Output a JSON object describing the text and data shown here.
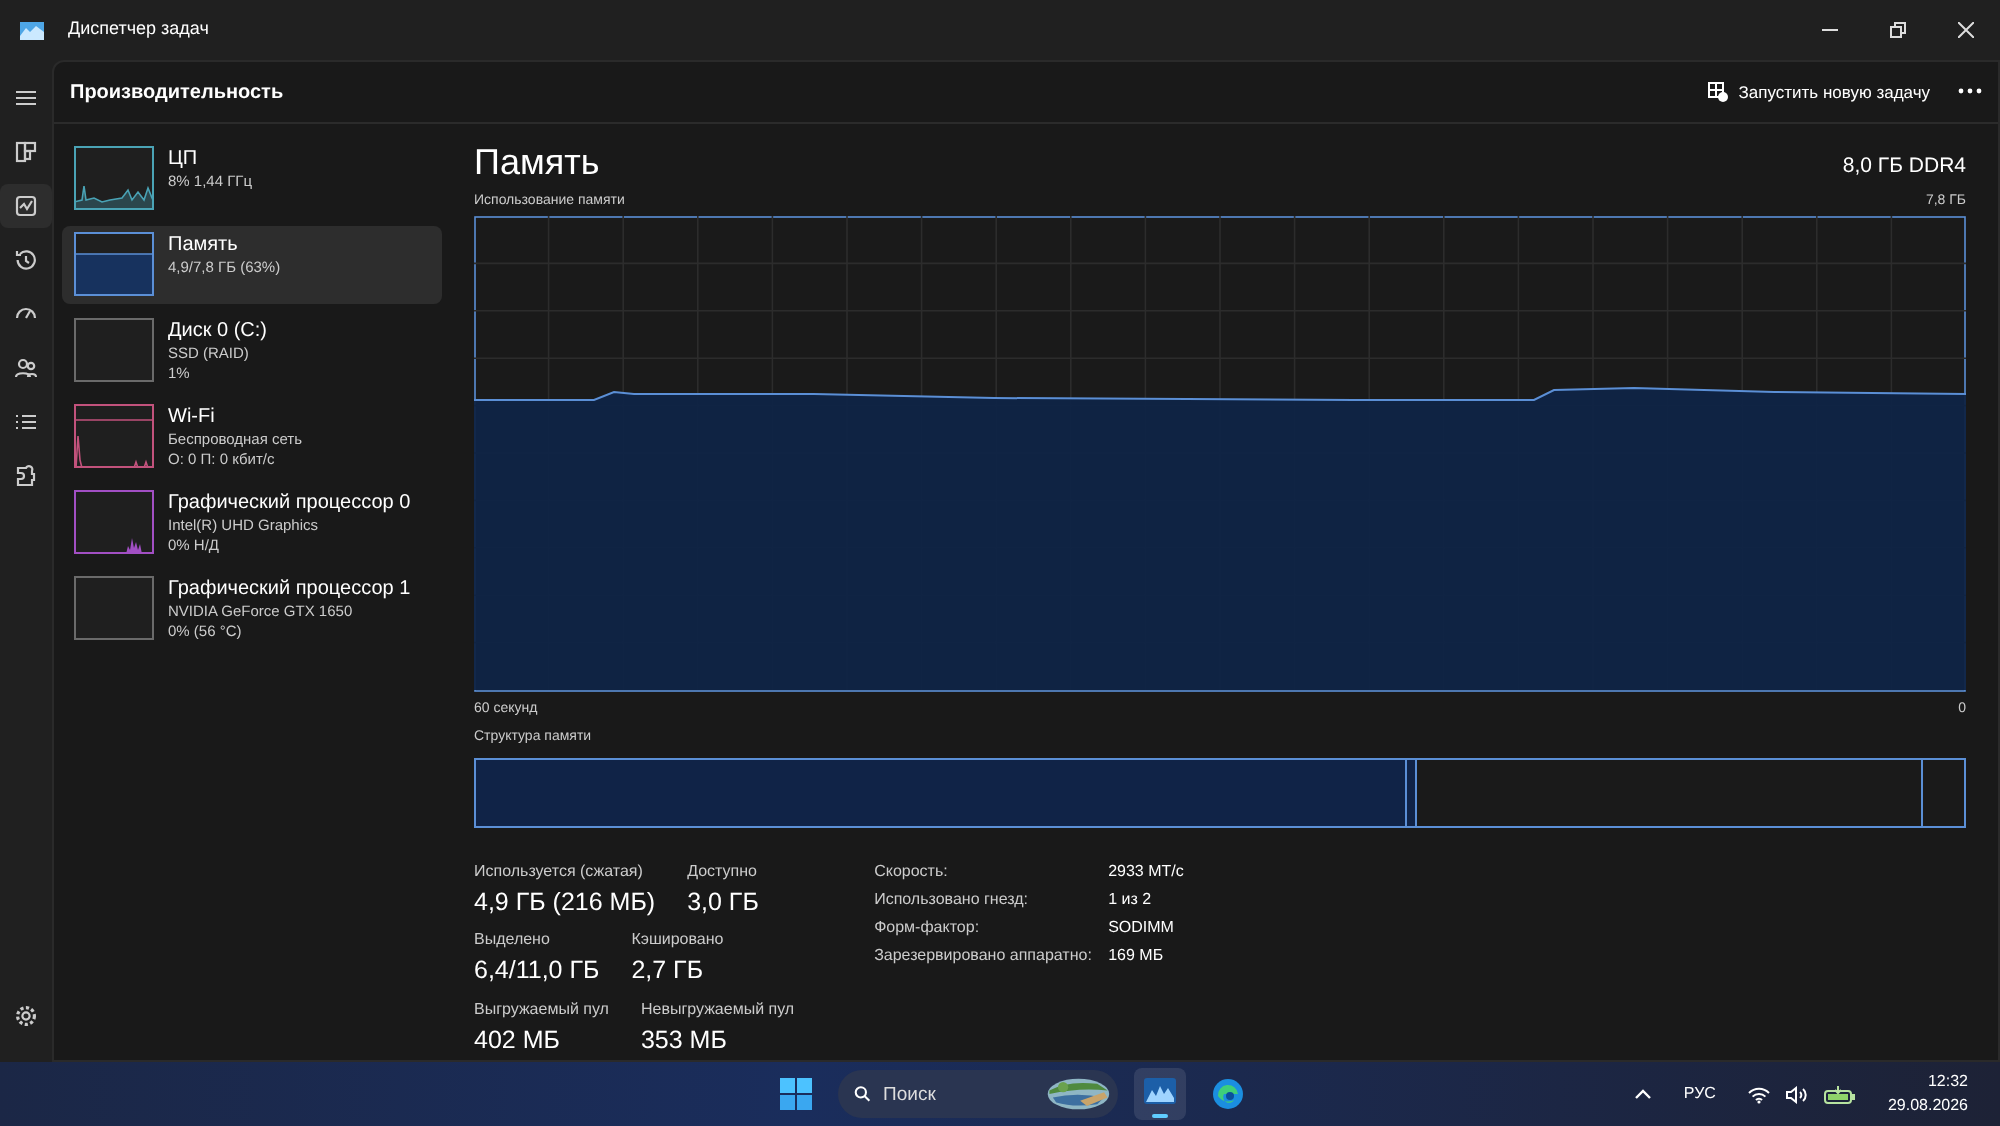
{
  "window": {
    "title": "Диспетчер задач"
  },
  "nav": [
    {
      "kind": "menu",
      "selected": false
    },
    {
      "kind": "processes",
      "selected": false
    },
    {
      "kind": "performance",
      "selected": true
    },
    {
      "kind": "history",
      "selected": false
    },
    {
      "kind": "startup",
      "selected": false
    },
    {
      "kind": "users",
      "selected": false
    },
    {
      "kind": "details",
      "selected": false
    },
    {
      "kind": "services",
      "selected": false
    }
  ],
  "nav_bottom": {
    "kind": "settings"
  },
  "header": {
    "title": "Производительность",
    "run_task": "Запустить новую задачу"
  },
  "devices": [
    {
      "name": "ЦП",
      "details": [
        "8% 1,44 ГГц"
      ],
      "selected": false,
      "color": "#4aa3b5",
      "kind": "spiky"
    },
    {
      "name": "Память",
      "details": [
        "4,9/7,8 ГБ (63%)"
      ],
      "selected": true,
      "color": "#5b8fd6",
      "kind": "fill"
    },
    {
      "name": "Диск 0 (C:)",
      "details": [
        "SSD (RAID)",
        "1%"
      ],
      "selected": false,
      "color": "#6a6a6a",
      "kind": "empty"
    },
    {
      "name": "Wi-Fi",
      "details": [
        "Беспроводная сеть",
        "О: 0 П: 0 кбит/с"
      ],
      "selected": false,
      "color": "#c2527c",
      "kind": "spike_left"
    },
    {
      "name": "Графический процессор 0",
      "details": [
        "Intel(R) UHD Graphics",
        "0% Н/Д"
      ],
      "selected": false,
      "color": "#a24fc4",
      "kind": "spike_right"
    },
    {
      "name": "Графический процессор 1",
      "details": [
        "NVIDIA GeForce GTX 1650",
        "0% (56 °C)"
      ],
      "selected": false,
      "color": "#6a6a6a",
      "kind": "empty"
    }
  ],
  "detail": {
    "title": "Память",
    "spec": "8,0 ГБ DDR4",
    "graph_label": "Использование памяти",
    "graph_max": "7,8 ГБ",
    "graph_time": "60 секунд",
    "graph_zero": "0",
    "structure_label": "Структура памяти",
    "stats": [
      [
        {
          "label": "Используется (сжатая)",
          "value": "4,9 ГБ (216 МБ)"
        },
        {
          "label": "Доступно",
          "value": "3,0 ГБ"
        }
      ],
      [
        {
          "label": "Выделено",
          "value": "6,4/11,0 ГБ"
        },
        {
          "label": "Кэшировано",
          "value": "2,7 ГБ"
        }
      ],
      [
        {
          "label": "Выгружаемый пул",
          "value": "402 МБ"
        },
        {
          "label": "Невыгружаемый пул",
          "value": "353 МБ"
        }
      ]
    ],
    "properties": [
      {
        "key": "Скорость:",
        "value": "2933 МТ/с"
      },
      {
        "key": "Использовано гнезд:",
        "value": "1 из 2"
      },
      {
        "key": "Форм-фактор:",
        "value": "SODIMM"
      },
      {
        "key": "Зарезервировано аппаратно:",
        "value": "169 МБ"
      }
    ]
  },
  "taskbar": {
    "search_placeholder": "Поиск",
    "apps": [
      {
        "kind": "task_manager",
        "selected": true
      },
      {
        "kind": "browser",
        "selected": false
      }
    ],
    "language": "РУС",
    "time": "12:32",
    "date": "29.08.2026"
  }
}
